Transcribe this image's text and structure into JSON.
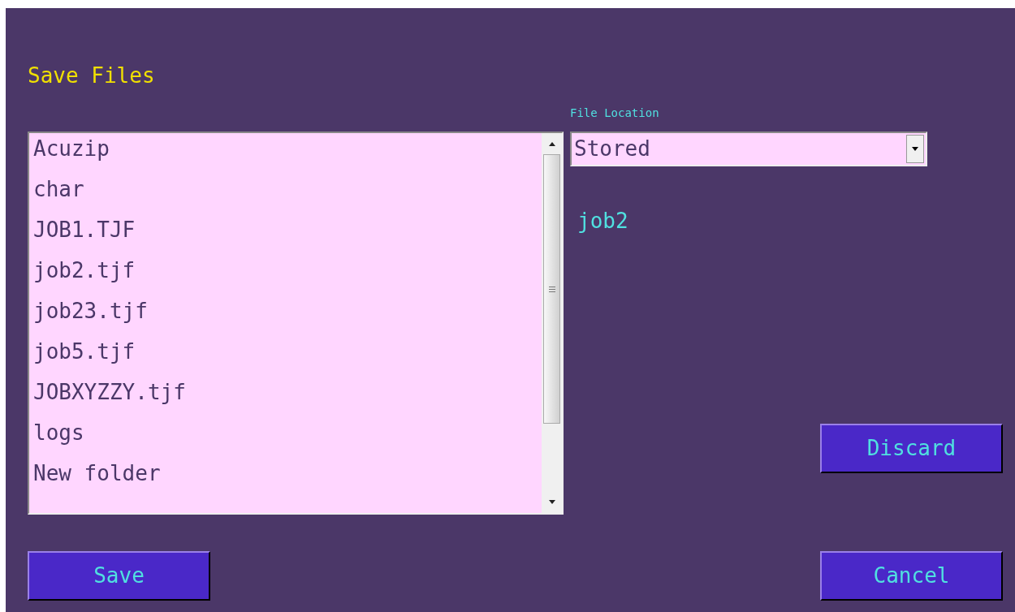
{
  "title": "Save Files",
  "file_list": {
    "items": [
      {
        "label": "Acuzip"
      },
      {
        "label": "char"
      },
      {
        "label": "JOB1.TJF"
      },
      {
        "label": "job2.tjf"
      },
      {
        "label": "job23.tjf"
      },
      {
        "label": "job5.tjf"
      },
      {
        "label": "JOBXYZZY.tjf"
      },
      {
        "label": "logs"
      },
      {
        "label": "New folder"
      }
    ]
  },
  "file_location": {
    "label": "File Location",
    "value": "Stored"
  },
  "file_name": "job2",
  "buttons": {
    "discard": "Discard",
    "save": "Save",
    "cancel": "Cancel"
  }
}
